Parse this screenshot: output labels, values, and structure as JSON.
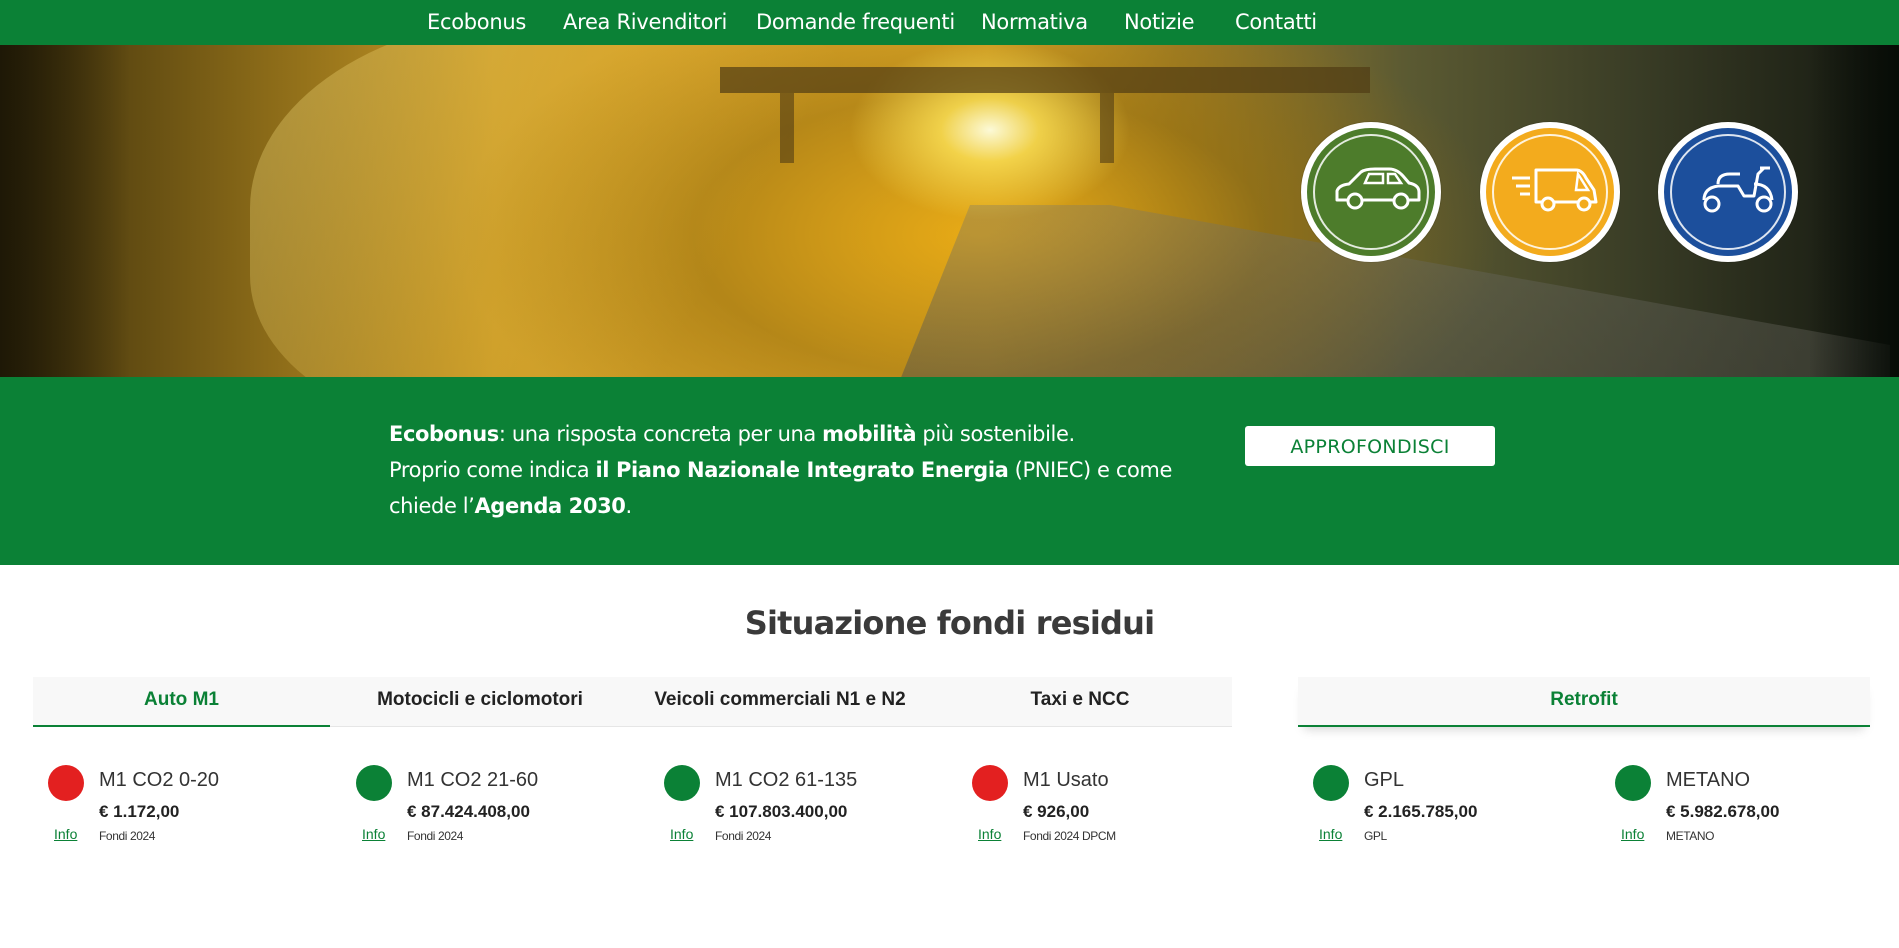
{
  "nav": {
    "items": [
      {
        "label": "Ecobonus"
      },
      {
        "label": "Area Rivenditori"
      },
      {
        "label": "Domande frequenti"
      },
      {
        "label": "Normativa"
      },
      {
        "label": "Notizie"
      },
      {
        "label": "Contatti"
      }
    ]
  },
  "hero": {
    "vehicles": [
      {
        "icon": "car-icon",
        "color": "#4d7c2b"
      },
      {
        "icon": "van-icon",
        "color": "#f3ab1d"
      },
      {
        "icon": "scooter-icon",
        "color": "#1c4f9c"
      }
    ]
  },
  "band": {
    "t1": "Ecobonus",
    "t2": ": una risposta concreta per una ",
    "t3": "mobilità",
    "t4": " più sostenibile.",
    "t5": "Proprio come indica ",
    "t6": "il Piano Nazionale Integrato Energia",
    "t7": " (PNIEC) e come chiede l’",
    "t8": "Agenda 2030",
    "t9": ".",
    "button_label": "APPROFONDISCI"
  },
  "funds": {
    "title": "Situazione fondi residui",
    "tabs": [
      {
        "label": "Auto M1",
        "active": true
      },
      {
        "label": "Motocicli e ciclomotori",
        "active": false
      },
      {
        "label": "Veicoli commerciali N1 e N2",
        "active": false
      },
      {
        "label": "Taxi e NCC",
        "active": false
      }
    ],
    "retrofit_tab": {
      "label": "Retrofit",
      "active": true
    },
    "items": [
      {
        "name": "M1 CO2 0-20",
        "amount": "€ 1.172,00",
        "note": "Fondi 2024",
        "status": "red",
        "info": "Info"
      },
      {
        "name": "M1 CO2 21-60",
        "amount": "€ 87.424.408,00",
        "note": "Fondi 2024",
        "status": "green",
        "info": "Info"
      },
      {
        "name": "M1 CO2 61-135",
        "amount": "€ 107.803.400,00",
        "note": "Fondi 2024",
        "status": "green",
        "info": "Info"
      },
      {
        "name": "M1 Usato",
        "amount": "€ 926,00",
        "note": "Fondi 2024 DPCM",
        "status": "red",
        "info": "Info"
      }
    ],
    "retrofit_items": [
      {
        "name": "GPL",
        "amount": "€ 2.165.785,00",
        "note": "GPL",
        "status": "green",
        "info": "Info"
      },
      {
        "name": "METANO",
        "amount": "€ 5.982.678,00",
        "note": "METANO",
        "status": "green",
        "info": "Info"
      }
    ],
    "status_colors": {
      "green": "#0b8136",
      "red": "#e32020"
    }
  }
}
